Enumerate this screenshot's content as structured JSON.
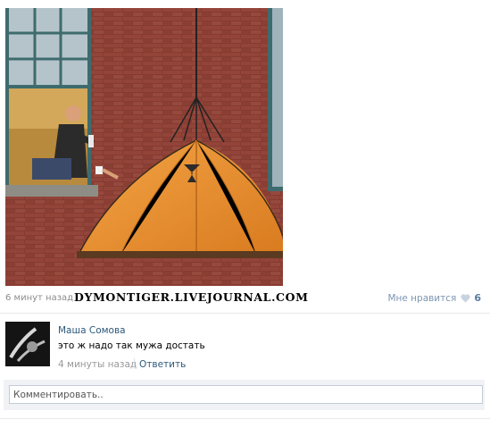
{
  "post": {
    "time": "6 минут назад",
    "source": "DYMONTIGER.LIVEJOURNAL.COM",
    "like_label": "Мне нравится",
    "like_count": "6"
  },
  "comment": {
    "author": "Маша Сомова",
    "text": "это ж надо так мужа достать",
    "time": "4 минуты назад",
    "reply_label": "Ответить"
  },
  "reply_box": {
    "placeholder": "Комментировать.."
  },
  "icons": {
    "like": "heart-icon"
  },
  "colors": {
    "link": "#2b587a",
    "muted": "#8c8c8c",
    "like_text": "#7d95b1",
    "tent": "#e8912f"
  }
}
